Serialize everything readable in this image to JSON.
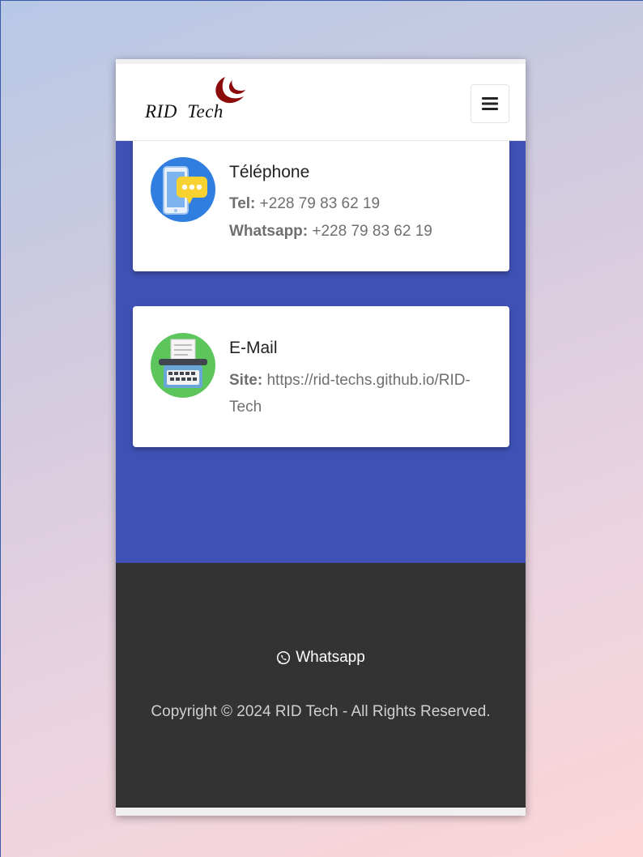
{
  "brand": {
    "logo_text": "RID  Tech",
    "logo_color": "#8b0a0a"
  },
  "navbar": {
    "menu_icon": "hamburger-menu-icon"
  },
  "contact": {
    "background_color": "#3f51b5",
    "phone_card": {
      "icon": "phone-chat-icon",
      "title": "Téléphone",
      "tel_label": "Tel:",
      "tel_value": "+228 79 83 62 19",
      "whatsapp_label": "Whatsapp:",
      "whatsapp_value": "+228 79 83 62 19"
    },
    "mail_card": {
      "icon": "typewriter-icon",
      "title": "E-Mail",
      "site_label": "Site:",
      "site_value_line1": "https://rid-techs.github.io/RID-",
      "site_value_line2": "Tech"
    }
  },
  "footer": {
    "background_color": "#333333",
    "whatsapp_label": "Whatsapp",
    "whatsapp_icon": "whatsapp-icon",
    "copyright": "Copyright © 2024 RID Tech - All Rights Reserved."
  }
}
